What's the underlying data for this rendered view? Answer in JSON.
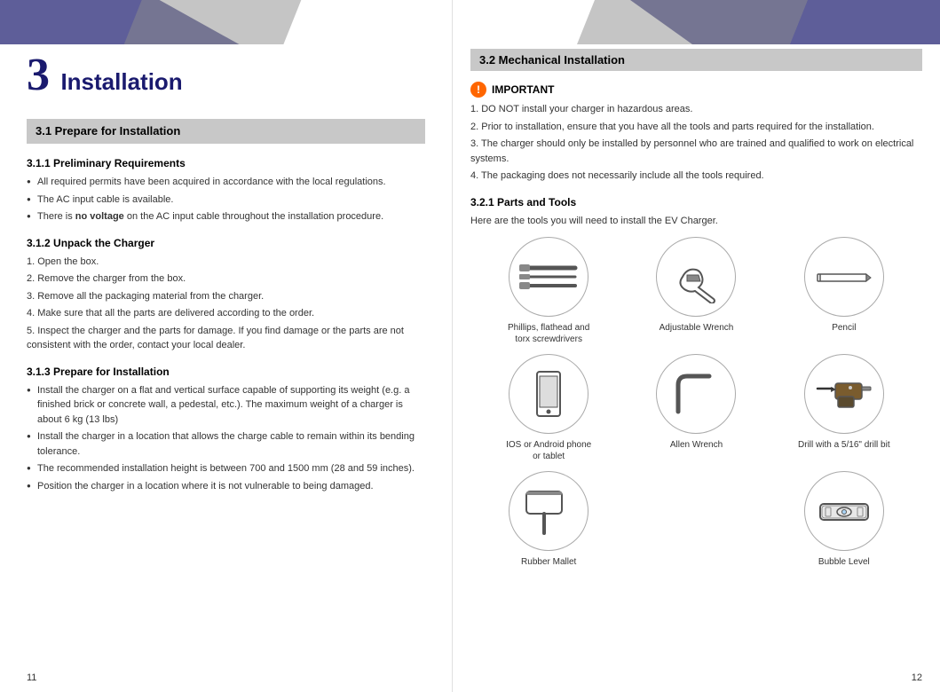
{
  "left": {
    "chapter_number": "3",
    "chapter_title": "Installation",
    "section_31": {
      "title": "3.1 Prepare for Installation",
      "subsections": [
        {
          "id": "311",
          "title": "3.1.1 Preliminary Requirements",
          "bullets": [
            "All required permits have been acquired in accordance with the local regulations.",
            "The AC input cable is available.",
            "There is <b>no voltage</b> on the AC input cable throughout the installation procedure."
          ]
        },
        {
          "id": "312",
          "title": "3.1.2 Unpack the Charger",
          "numbered": [
            "1. Open the box.",
            "2. Remove the charger from the box.",
            "3. Remove all the packaging material from the charger.",
            "4. Make sure that all the parts are delivered according to the order.",
            "5. Inspect the charger and the parts for damage. If you find damage or the parts are not consistent with the order, contact your local dealer."
          ]
        },
        {
          "id": "313",
          "title": "3.1.3 Prepare for Installation",
          "bullets": [
            "Install the charger on a flat and vertical surface capable of supporting its weight (e.g. a finished brick or concrete wall, a pedestal, etc.). The maximum weight of a charger is about 6 kg (13 lbs)",
            "Install the charger in a location that allows the charge cable to remain within its bending tolerance.",
            "The recommended installation height is between 700 and 1500 mm (28 and 59 inches).",
            "Position the charger in a location where it is not vulnerable to being damaged."
          ]
        }
      ]
    },
    "page_number": "11"
  },
  "right": {
    "section_32": {
      "title": "3.2 Mechanical Installation",
      "important": {
        "label": "IMPORTANT",
        "items": [
          "1. DO NOT install your charger in hazardous areas.",
          "2. Prior to installation, ensure that you have all the tools and parts required for the installation.",
          "3. The charger should only be installed by personnel who are trained and qualified to work on electrical systems.",
          "4. The packaging does not necessarily include all the tools required."
        ]
      },
      "subsection_321": {
        "title": "3.2.1 Parts and Tools",
        "intro": "Here are the tools you will need to install the EV Charger.",
        "tools": [
          {
            "id": "screwdrivers",
            "label": "Phillips, flathead and\ntorx screwdrivers"
          },
          {
            "id": "adjustable-wrench",
            "label": "Adjustable Wrench"
          },
          {
            "id": "pencil",
            "label": "Pencil"
          },
          {
            "id": "phone",
            "label": "IOS or Android phone\nor tablet"
          },
          {
            "id": "allen-wrench",
            "label": "Allen Wrench"
          },
          {
            "id": "drill",
            "label": "Drill with a 5/16\" drill bit"
          },
          {
            "id": "mallet",
            "label": "Rubber Mallet"
          },
          {
            "id": "bubble-level",
            "label": "Bubble Level"
          }
        ]
      }
    },
    "page_number": "12"
  }
}
